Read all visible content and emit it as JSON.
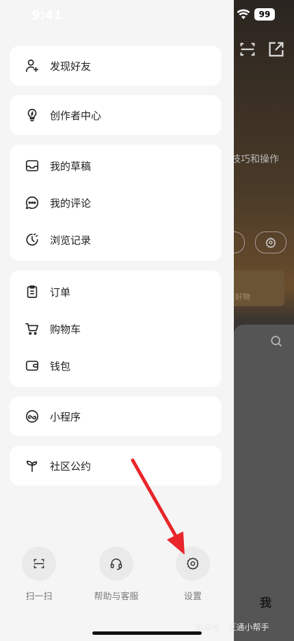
{
  "status": {
    "time": "9:41",
    "battery": "99"
  },
  "menu": {
    "find_friends": "发现好友",
    "creator_center": "创作者中心",
    "drafts": "我的草稿",
    "comments": "我的评论",
    "history": "浏览记录",
    "orders": "订单",
    "cart": "购物车",
    "wallet": "钱包",
    "mini_programs": "小程序",
    "community": "社区公约"
  },
  "bottom": {
    "scan": "扫一扫",
    "help": "帮助与客服",
    "settings": "设置"
  },
  "background": {
    "hint_text": "技巧和操作",
    "card_title": "好物",
    "tab_me": "我"
  },
  "watermark": "公众号 · 互通小帮手",
  "colors": {
    "arrow": "#e8262b",
    "drawer_bg": "#f5f5f5",
    "card_bg": "#ffffff"
  }
}
